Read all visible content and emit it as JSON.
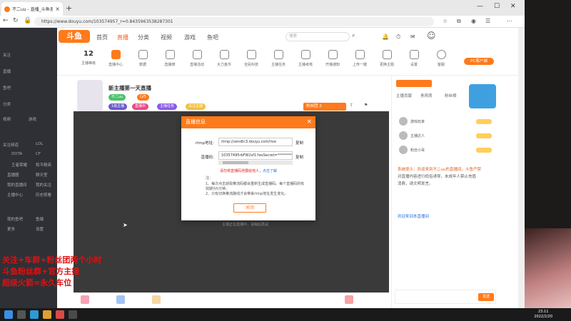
{
  "browser": {
    "tab_title": "不二uu - 直播_斗鱼无需直播_斗...",
    "url": "https://www.douyu.com/103574957_r=0.8435963538287301",
    "tab_close": "×",
    "new_tab": "+"
  },
  "site": {
    "logo_text": "斗鱼",
    "nav": [
      "首页",
      "直播",
      "分类",
      "视频",
      "游戏",
      "鱼吧"
    ],
    "search_placeholder": "搜索",
    "pc_client": "PC客户端"
  },
  "categories": {
    "count_value": "12",
    "count_label": "主播等级",
    "items": [
      "直播中心",
      "数据",
      "直播榜",
      "直播活动",
      "大力金币",
      "全民科技",
      "主播任务",
      "主播考核",
      "开播通知",
      "上传一键",
      "更换主题",
      "设置",
      "客服"
    ]
  },
  "left_sidebar": {
    "items": [
      "关注",
      "直播",
      "鱼吧",
      "分类",
      "视频",
      "游戏",
      "关注频道",
      "LOL",
      "DOTA",
      "CF",
      "王者荣耀",
      "和平精英",
      "直播圈",
      "聊天室",
      "我的直播间",
      "我的关注",
      "主播中心",
      "历史观看",
      "我的鱼吧",
      "鱼塘",
      "更多",
      "设置"
    ]
  },
  "streamer": {
    "title": "新主播第一天直播",
    "tags": [
      "不二uu",
      "LV5"
    ],
    "pills": [
      "1级主播",
      "直播中",
      "主播任务",
      "关注主播"
    ],
    "fan_button": "粉丝团 2"
  },
  "right_panel": {
    "tab_labels": [
      "主播贡献",
      "贵宾席",
      "粉丝榜"
    ],
    "rank_names": [
      "游戏玩家",
      "主播达人",
      "粉丝小哥"
    ],
    "chat_lines": [
      "系统提示：欢迎来到不二uu的直播间，斗鱼严禁",
      "对直播内容进行低俗诱导，未成年人禁止充值",
      "消费，请文明发言。",
      "欢迎来到本直播间"
    ],
    "send_label": "发送"
  },
  "overlay_text": [
    "关注+车群+粉丝团两个小时",
    "斗鱼粉丝群+官方主播",
    "超级火箭=永久车位"
  ],
  "dialog": {
    "title": "直播信息",
    "close": "×",
    "rtmp_label": "rtmp地址:",
    "rtmp_value": "rtmp://sendtc3.douyu.com/live",
    "code_label": "直播码:",
    "code_value": "10357495rbFW2sf1?wsSecret=***********",
    "copy_label": "复制",
    "warn_text": "请勿将直播码泄露给他人，",
    "warn_link": "点击了解",
    "note_title": "注：",
    "note_1": "1、每次点击获取推流码都会重新生成直播码。每个直播码的有效期为5分钟。",
    "note_2": "2、只有切换推流路线才会带来rtmp地址发生变化。",
    "ok_button": "关闭"
  },
  "video": {
    "caption": "主播正在直播中，请稍后再试"
  },
  "taskbar": {
    "time": "23:11",
    "date": "2022/2/20"
  }
}
